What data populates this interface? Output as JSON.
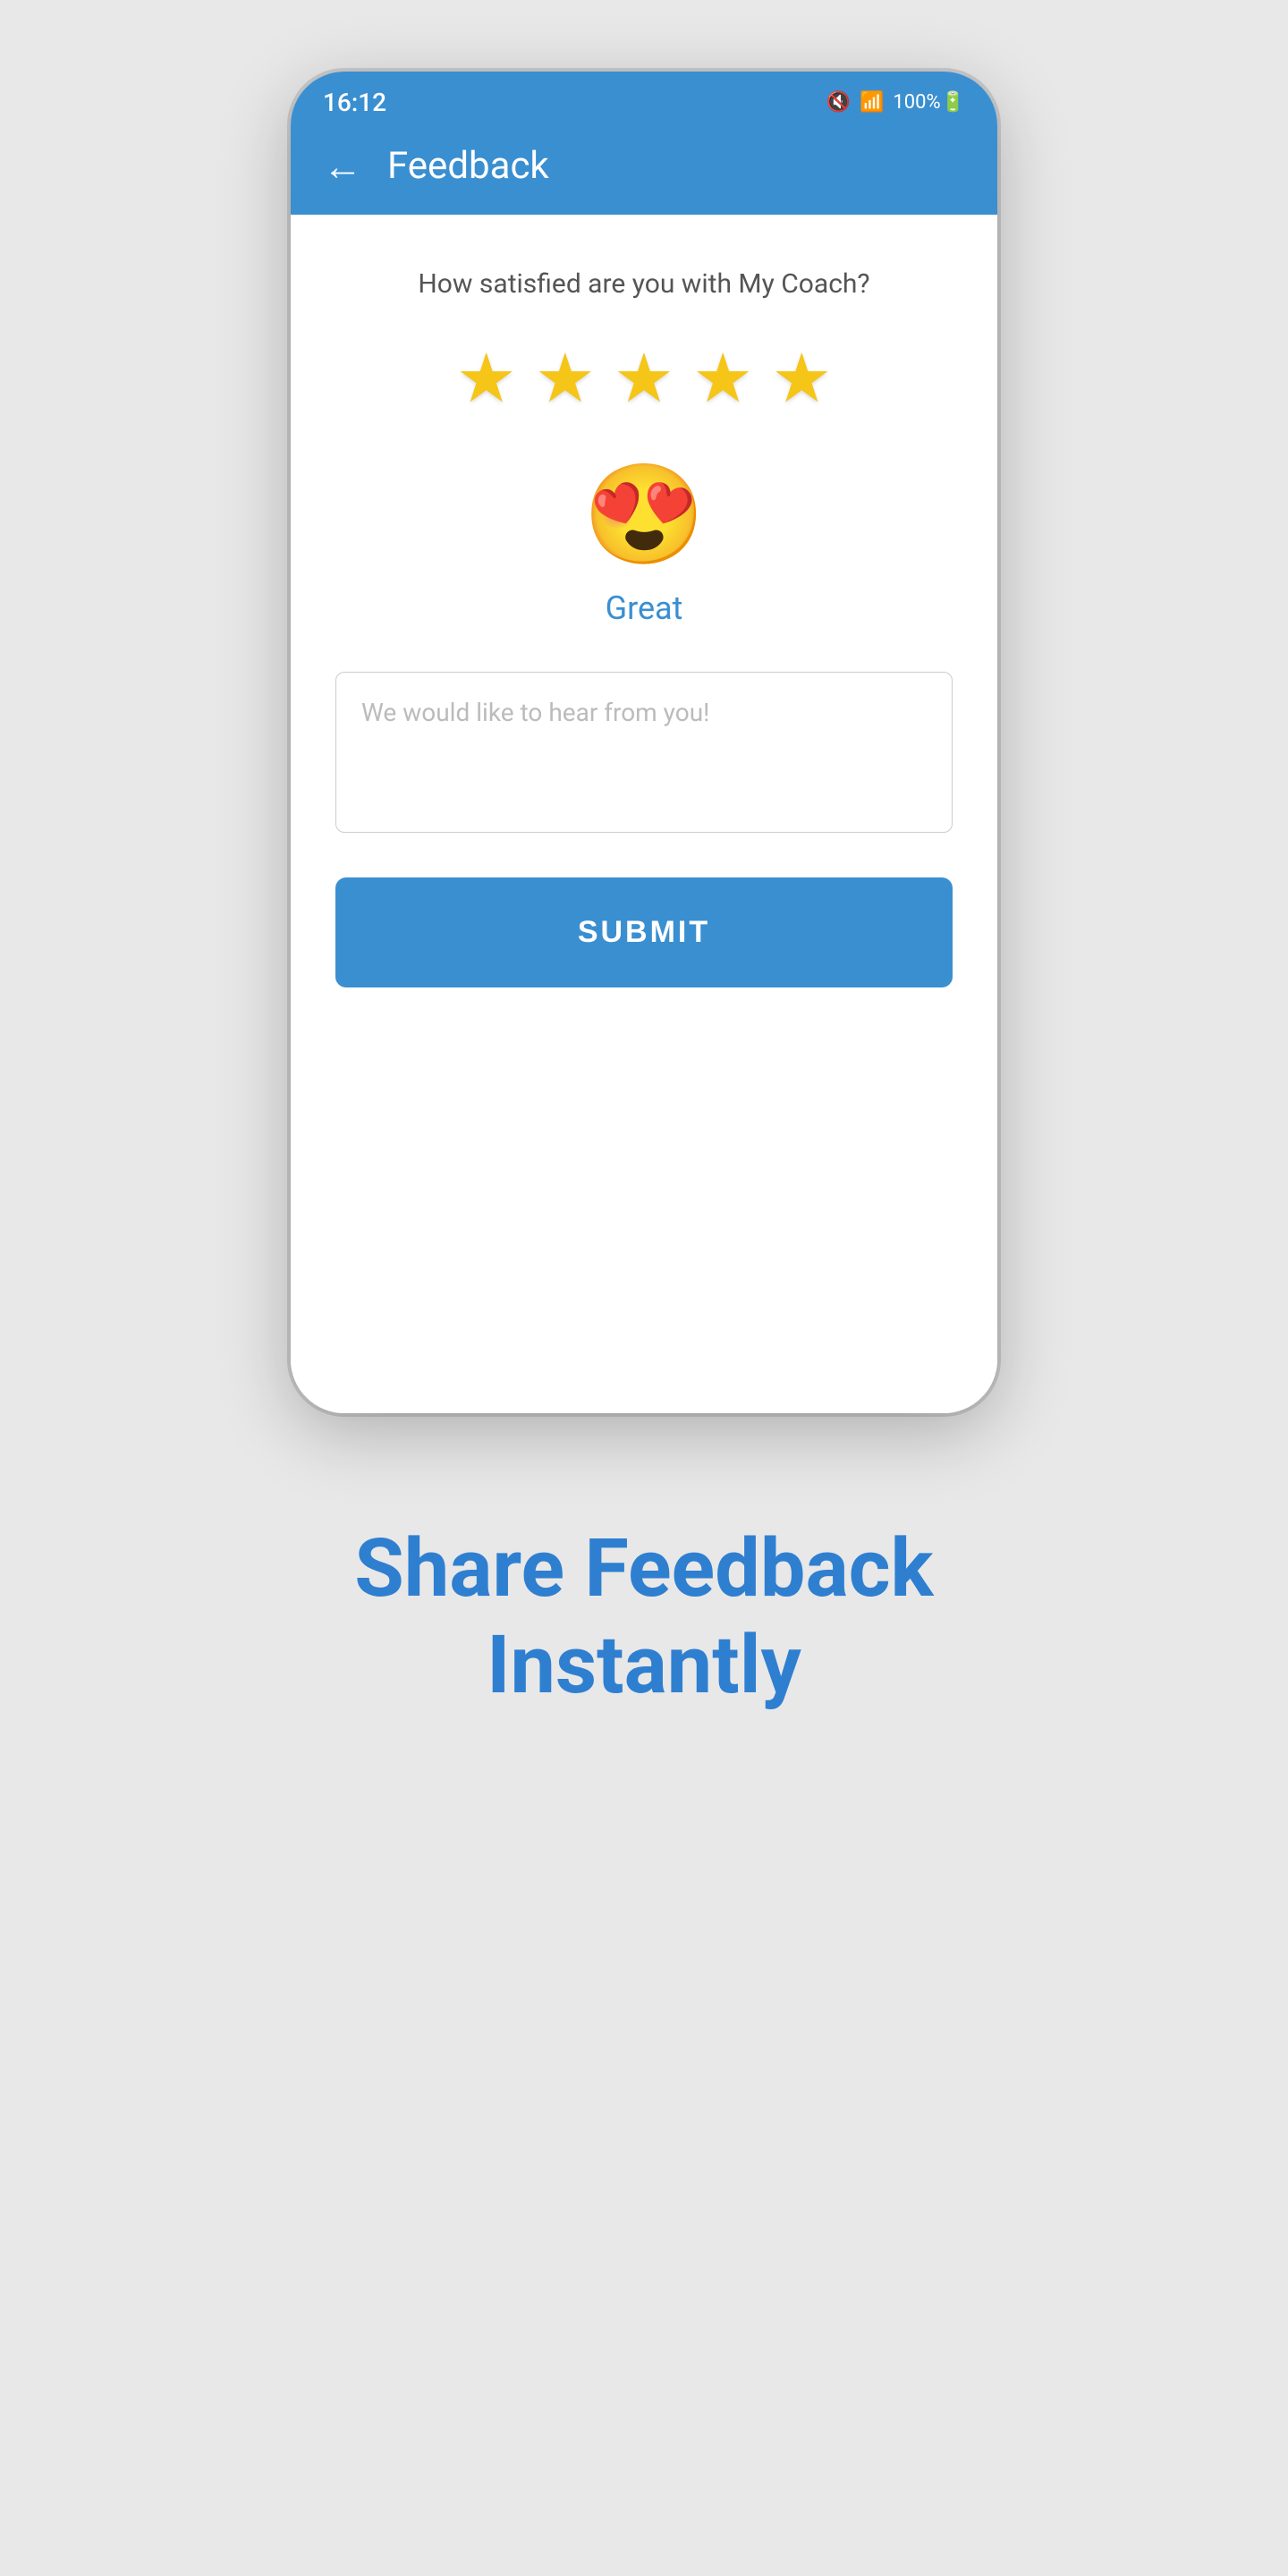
{
  "page": {
    "background_color": "#e8e8e8"
  },
  "status_bar": {
    "time": "16:12",
    "icons": "🔇 📶 100%"
  },
  "header": {
    "title": "Feedback",
    "back_arrow": "←"
  },
  "main": {
    "satisfaction_question": "How satisfied are you with My Coach?",
    "stars": [
      {
        "filled": true
      },
      {
        "filled": true
      },
      {
        "filled": true
      },
      {
        "filled": true
      },
      {
        "filled": true
      }
    ],
    "rating_emoji": "😍",
    "rating_label": "Great",
    "feedback_placeholder": "We would like to hear from you!",
    "submit_label": "SUBMIT"
  },
  "tagline": {
    "line1": "Share Feedback",
    "line2": "Instantly"
  }
}
